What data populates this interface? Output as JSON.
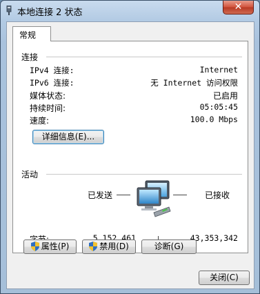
{
  "window": {
    "title": "本地连接 2 状态",
    "close_glyph": "✕",
    "icon": "network-adapter-icon"
  },
  "tabs": [
    {
      "label": "常规",
      "active": true
    }
  ],
  "connection": {
    "heading": "连接",
    "rows": [
      {
        "label": "IPv4 连接:",
        "value": "Internet"
      },
      {
        "label": "IPv6 连接:",
        "value": "无 Internet 访问权限"
      },
      {
        "label": "媒体状态:",
        "value": "已启用"
      },
      {
        "label": "持续时间:",
        "value": "05:05:45"
      },
      {
        "label": "速度:",
        "value": "100.0 Mbps"
      }
    ],
    "details_button": "详细信息(E)..."
  },
  "activity": {
    "heading": "活动",
    "sent_label": "已发送",
    "received_label": "已接收",
    "bytes_label": "字节:",
    "bytes_sent": "5,152,461",
    "bytes_received": "43,353,342",
    "icon": "network-computers-icon"
  },
  "buttons": {
    "properties": "属性(P)",
    "disable": "禁用(D)",
    "diagnose": "诊断(G)",
    "close": "关闭(C)"
  },
  "colors": {
    "frame": "#a9c2dd",
    "close_button": "#c9452e",
    "focus_border": "#3c7fb1"
  }
}
